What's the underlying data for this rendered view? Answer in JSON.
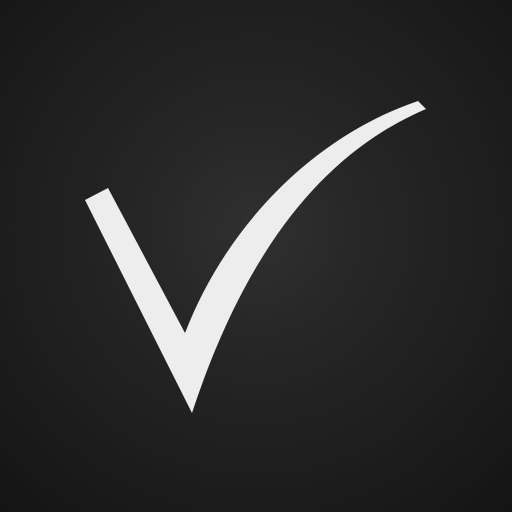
{
  "icon": {
    "name": "checkmark-icon",
    "background_color": "#262626",
    "mark_color": "#ededed"
  }
}
